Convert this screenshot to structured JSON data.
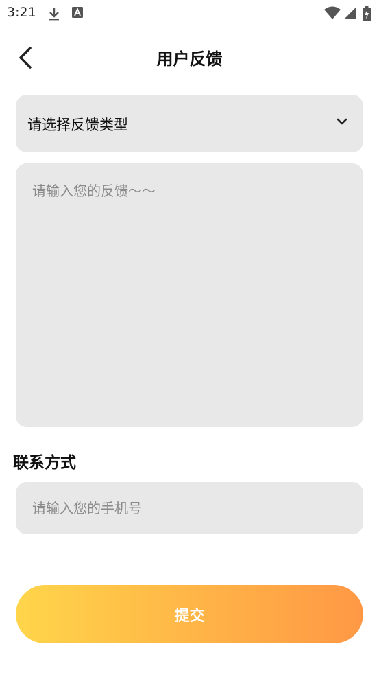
{
  "status_bar": {
    "time": "3:21",
    "icons": [
      "download-icon",
      "a-badge-icon",
      "wifi-icon",
      "signal-icon",
      "battery-charging-icon"
    ]
  },
  "header": {
    "title": "用户反馈",
    "back_icon": "back-arrow-icon"
  },
  "feedback_type": {
    "label": "请选择反馈类型",
    "icon": "chevron-down-icon"
  },
  "feedback_content": {
    "placeholder": "请输入您的反馈～～"
  },
  "contact": {
    "section_title": "联系方式",
    "placeholder": "请输入您的手机号"
  },
  "submit": {
    "label": "提交",
    "gradient_start": "#ffd54a",
    "gradient_end": "#ff9845"
  },
  "colors": {
    "field_background": "#e8e8e8",
    "placeholder_text": "#8a8a8a"
  }
}
